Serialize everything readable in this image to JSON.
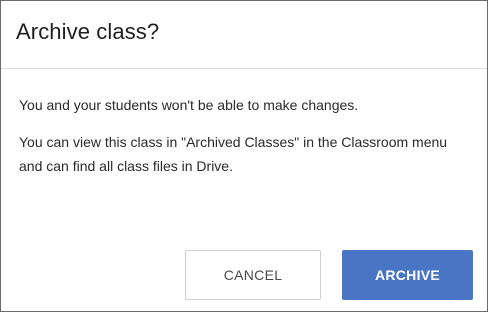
{
  "dialog": {
    "title": "Archive class?",
    "body": [
      "You and your students won't be able to make changes.",
      "You can view this class in \"Archived Classes\" in the Classroom menu and can find all class files in Drive."
    ],
    "buttons": {
      "cancel_label": "CANCEL",
      "archive_label": "ARCHIVE"
    }
  },
  "colors": {
    "primary_button": "#4a74c4",
    "border": "#6b6b6b"
  }
}
